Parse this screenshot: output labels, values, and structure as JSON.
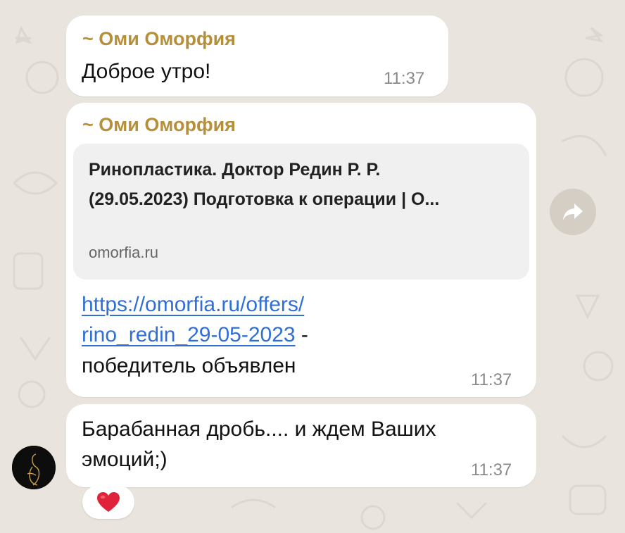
{
  "messages": [
    {
      "sender": "~ Оми Оморфия",
      "text": "Доброе утро!",
      "time": "11:37"
    },
    {
      "sender": "~ Оми Оморфия",
      "preview": {
        "title_line1": "Ринопластика. Доктор Редин Р. Р.",
        "title_line2": "(29.05.2023) Подготовка к операции | О...",
        "domain": "omorfia.ru"
      },
      "link_line1": "https://omorfia.ru/offers/",
      "link_line2": "rino_redin_29-05-2023",
      "text_after_link": " -",
      "text_line3": "победитель объявлен",
      "time": "11:37"
    },
    {
      "text_line1": "Барабанная дробь.... и ждем Ваших",
      "text_line2": "эмоций;)",
      "time": "11:37",
      "reaction": "❤️"
    }
  ],
  "icons": {
    "share": "share-forward-icon",
    "avatar": "avatar",
    "reaction": "heart-emoji"
  },
  "colors": {
    "sender": "#b58f3a",
    "link": "#2f6fd6",
    "background": "#e9e5de",
    "bubble": "#ffffff"
  }
}
